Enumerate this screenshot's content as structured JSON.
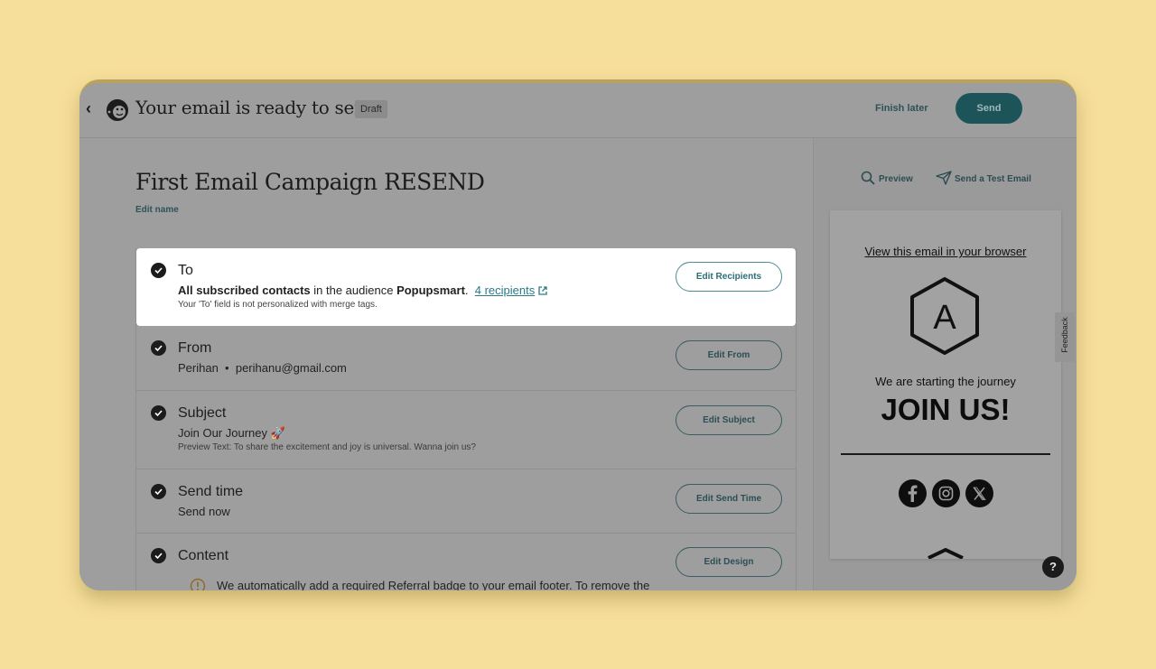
{
  "header": {
    "title": "Your email is ready to send!",
    "status_badge": "Draft",
    "finish_later": "Finish later",
    "send": "Send"
  },
  "campaign": {
    "name": "First Email Campaign RESEND",
    "edit_name": "Edit name"
  },
  "checklist": {
    "to": {
      "title": "To",
      "summary_bold_1": "All subscribed contacts",
      "summary_mid": " in the audience ",
      "summary_bold_2": "Popupsmart",
      "summary_end": ".",
      "recipients_link": "4 recipients",
      "note": "Your 'To' field is not personalized with merge tags.",
      "button": "Edit Recipients"
    },
    "from": {
      "title": "From",
      "name": "Perihan",
      "separator": "•",
      "email": "perihanu@gmail.com",
      "button": "Edit From"
    },
    "subject": {
      "title": "Subject",
      "value": "Join Our Journey 🚀",
      "preview_text": "Preview Text: To share the excitement and joy is universal. Wanna join us?",
      "button": "Edit Subject"
    },
    "send_time": {
      "title": "Send time",
      "value": "Send now",
      "button": "Edit Send Time"
    },
    "content": {
      "title": "Content",
      "notice": "We automatically add a required Referral badge to your email footer. To remove the",
      "button": "Edit Design"
    }
  },
  "sidebar": {
    "preview": "Preview",
    "send_test": "Send a Test Email",
    "email_preview": {
      "view_in_browser": "View this email in your browser",
      "logo_letter": "A",
      "tagline": "We are starting the journey",
      "headline": "JOIN US!",
      "social_icons": [
        "facebook-icon",
        "instagram-icon",
        "x-icon"
      ]
    },
    "feedback": "Feedback",
    "help": "?"
  },
  "colors": {
    "background": "#f6df9a",
    "accent": "#1d545a",
    "link": "#2b7a86"
  }
}
